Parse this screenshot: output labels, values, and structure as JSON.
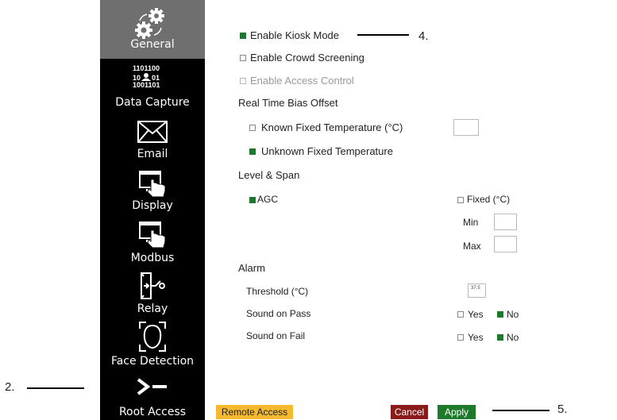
{
  "sidebar": {
    "items": [
      {
        "label": "General",
        "icon": "gears-icon",
        "active": true
      },
      {
        "label": "Data Capture",
        "icon": "user-binary-icon",
        "binary": [
          "1101100",
          "10",
          "01",
          "1001101"
        ]
      },
      {
        "label": "Email",
        "icon": "envelope-icon"
      },
      {
        "label": "Display",
        "icon": "monitor-hand-icon"
      },
      {
        "label": "Modbus",
        "icon": "monitor-hand-icon"
      },
      {
        "label": "Relay",
        "icon": "relay-icon"
      },
      {
        "label": "Face Detection",
        "icon": "face-frame-icon"
      },
      {
        "label": "Root Access",
        "icon": "terminal-prompt-icon"
      }
    ]
  },
  "general": {
    "kiosk_mode": {
      "label": "Enable Kiosk Mode",
      "checked": true
    },
    "crowd_screening": {
      "label": "Enable Crowd Screening",
      "checked": false
    },
    "access_control": {
      "label": "Enable Access Control",
      "checked": false,
      "disabled": true
    }
  },
  "bias_offset": {
    "heading": "Real Time Bias Offset",
    "known_fixed": {
      "label": "Known Fixed Temperature (°C)",
      "checked": false,
      "value": ""
    },
    "unknown_fixed": {
      "label": "Unknown Fixed Temperature",
      "checked": true
    }
  },
  "level_span": {
    "heading": "Level & Span",
    "agc": {
      "label": "AGC",
      "checked": true
    },
    "fixed": {
      "label": "Fixed (°C)",
      "checked": false
    },
    "min_label": "Min",
    "min_value": "",
    "max_label": "Max",
    "max_value": ""
  },
  "alarm": {
    "heading": "Alarm",
    "threshold_label": "Threshold (°C)",
    "threshold_value": "37.5",
    "sound_pass": {
      "label": "Sound on Pass",
      "yes_label": "Yes",
      "no_label": "No",
      "selected": "No"
    },
    "sound_fail": {
      "label": "Sound on Fail",
      "yes_label": "Yes",
      "no_label": "No",
      "selected": "No"
    }
  },
  "footer": {
    "remote_access": "Remote Access",
    "cancel": "Cancel",
    "apply": "Apply"
  },
  "callouts": {
    "c2": "2.",
    "c4": "4.",
    "c5": "5."
  },
  "colors": {
    "sidebar_bg": "#000000",
    "active_bg": "#6f6f6f",
    "check_on": "#1d7a2a",
    "remote_access_bg": "#f5b82e",
    "cancel_bg": "#8b1a1a",
    "apply_bg": "#1d7a2a"
  }
}
